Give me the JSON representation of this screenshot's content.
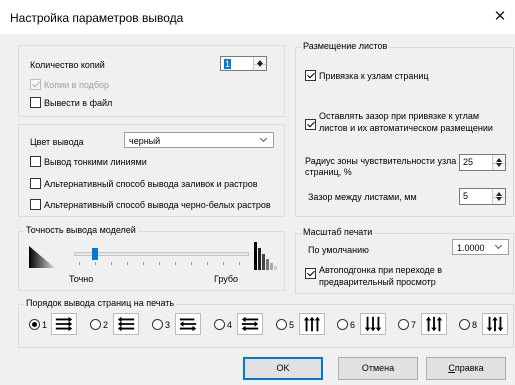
{
  "window": {
    "title": "Настройка параметров вывода",
    "close_glyph": "✕"
  },
  "copies": {
    "label": "Количество копий",
    "value": "1",
    "collate_label": "Копии в подбор",
    "collate_checked": true,
    "collate_disabled": true,
    "to_file_label": "Вывести в файл",
    "to_file_checked": false
  },
  "color": {
    "label": "Цвет вывода",
    "value": "черный",
    "thin_lines_label": "Вывод тонкими линиями",
    "alt_fill_label": "Альтернативный способ вывода заливок и растров",
    "alt_bw_label": "Альтернативный способ вывода черно-белых растров"
  },
  "accuracy": {
    "group_label": "Точность вывода моделей",
    "left_label": "Точно",
    "right_label": "Грубо",
    "level": 0.1
  },
  "placement": {
    "group_label": "Размещение листов",
    "snap_label": "Привязка к узлам страниц",
    "snap_checked": true,
    "gap_label_1": "Оставлять зазор при привязке к углам",
    "gap_label_2": "листов и их автоматическом размещении",
    "gap_checked": true,
    "radius_label_1": "Радиус зоны чувствительности узла",
    "radius_label_2": "страниц, %",
    "radius_value": "25",
    "gap_mm_label": "Зазор между листами, мм",
    "gap_mm_value": "5"
  },
  "scale": {
    "group_label": "Масштаб печати",
    "default_label": "По умолчанию",
    "value": "1.0000",
    "autofit_label_1": "Автоподгонка при переходе в",
    "autofit_label_2": "предварительный просмотр",
    "autofit_checked": true
  },
  "order": {
    "group_label": "Порядок вывода страниц на печать",
    "options": [
      "1",
      "2",
      "3",
      "4",
      "5",
      "6",
      "7",
      "8"
    ],
    "selected": "1"
  },
  "buttons": {
    "ok": "OK",
    "cancel": "Отмена",
    "help_underlined": "С",
    "help_rest": "правка"
  },
  "colors": {
    "accent": "#0078d7",
    "background": "#f0f0f0"
  }
}
